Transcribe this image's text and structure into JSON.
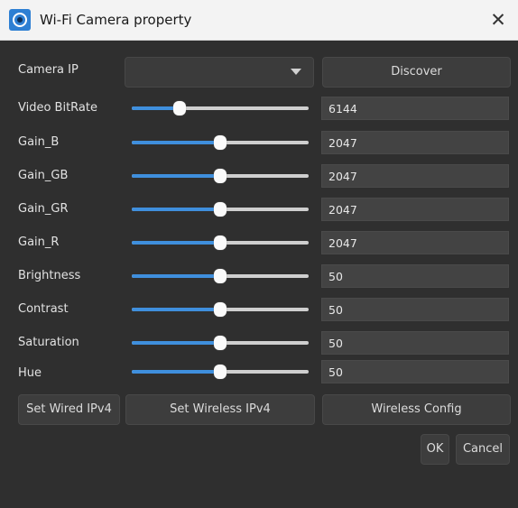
{
  "window": {
    "title": "Wi-Fi Camera property",
    "close_glyph": "✕",
    "icon": "camera-app-icon"
  },
  "camera_ip": {
    "label": "Camera IP",
    "value": ""
  },
  "discover_label": "Discover",
  "sliders": [
    {
      "label": "Video BitRate",
      "value": "6144",
      "fraction": 0.27
    },
    {
      "label": "Gain_B",
      "value": "2047",
      "fraction": 0.5
    },
    {
      "label": "Gain_GB",
      "value": "2047",
      "fraction": 0.5
    },
    {
      "label": "Gain_GR",
      "value": "2047",
      "fraction": 0.5
    },
    {
      "label": "Gain_R",
      "value": "2047",
      "fraction": 0.5
    },
    {
      "label": "Brightness",
      "value": "50",
      "fraction": 0.5
    },
    {
      "label": "Contrast",
      "value": "50",
      "fraction": 0.5
    },
    {
      "label": "Saturation",
      "value": "50",
      "fraction": 0.5
    },
    {
      "label": "Hue",
      "value": "50",
      "fraction": 0.5
    }
  ],
  "buttons": {
    "set_wired": "Set Wired IPv4",
    "set_wireless": "Set Wireless IPv4",
    "wireless_config": "Wireless Config",
    "ok": "OK",
    "cancel": "Cancel"
  },
  "colors": {
    "accent": "#3f8fdd",
    "background": "#2f2f2f",
    "titlebar": "#f3f3f3"
  }
}
